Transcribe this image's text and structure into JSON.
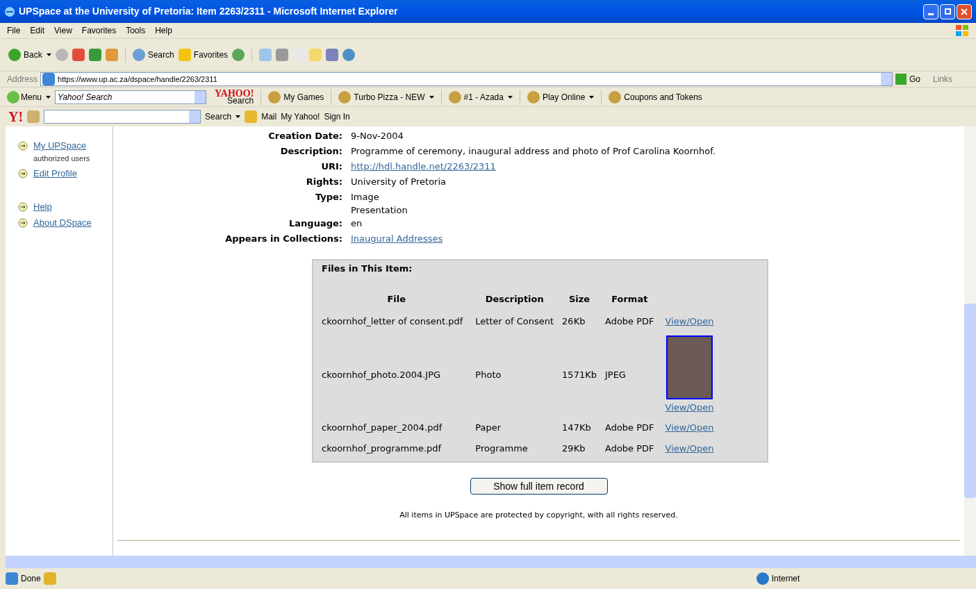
{
  "window": {
    "title": "UPSpace at the University of Pretoria: Item 2263/2311 - Microsoft Internet Explorer"
  },
  "menu_bar": [
    "File",
    "Edit",
    "View",
    "Favorites",
    "Tools",
    "Help"
  ],
  "toolbar": {
    "back": "Back",
    "search": "Search",
    "favorites": "Favorites"
  },
  "address_bar": {
    "label": "Address",
    "value": "https://www.up.ac.za/dspace/handle/2263/2311",
    "go": "Go",
    "links": "Links"
  },
  "yahoo_toolbar": {
    "menu": "Menu",
    "search_value": "Yahoo! Search",
    "logo": "YAHOO!",
    "logo_sub": "Search",
    "items": [
      {
        "label": "My Games",
        "dropdown": false
      },
      {
        "label": "Turbo Pizza - NEW",
        "dropdown": true
      },
      {
        "label": "#1 - Azada",
        "dropdown": true
      },
      {
        "label": "Play Online",
        "dropdown": true
      },
      {
        "label": "Coupons and Tokens",
        "dropdown": false
      }
    ]
  },
  "yahoo_toolbar_2": {
    "logo": "Y!",
    "search": "Search",
    "items": [
      "Mail",
      "My Yahoo!",
      "Sign In"
    ]
  },
  "sidebar": {
    "items": [
      {
        "label": "My UPSpace",
        "note": "authorized users"
      },
      {
        "label": "Edit Profile"
      },
      {
        "label": "Help"
      },
      {
        "label": "About DSpace"
      }
    ]
  },
  "metadata": [
    {
      "label": "Creation Date:",
      "kind": "text",
      "values": [
        "9-Nov-2004"
      ]
    },
    {
      "label": "Description:",
      "kind": "text",
      "values": [
        "Programme of ceremony, inaugural address and photo of Prof Carolina Koornhof."
      ]
    },
    {
      "label": "URI:",
      "kind": "link",
      "values": [
        "http://hdl.handle.net/2263/2311"
      ]
    },
    {
      "label": "Rights:",
      "kind": "text",
      "values": [
        "University of Pretoria"
      ]
    },
    {
      "label": "Type:",
      "kind": "text",
      "values": [
        "Image",
        "Presentation"
      ]
    },
    {
      "label": "Language:",
      "kind": "text",
      "values": [
        "en"
      ]
    },
    {
      "label": "Appears in Collections:",
      "kind": "link",
      "values": [
        "Inaugural Addresses"
      ]
    }
  ],
  "files": {
    "title": "Files in This Item:",
    "columns": [
      "File",
      "Description",
      "Size",
      "Format"
    ],
    "rows": [
      {
        "file": "ckoornhof_letter of consent.pdf",
        "description": "Letter of Consent",
        "size": "26Kb",
        "format": "Adobe PDF",
        "link": "View/Open",
        "thumbnail": false
      },
      {
        "file": "ckoornhof_photo.2004.JPG",
        "description": "Photo",
        "size": "1571Kb",
        "format": "JPEG",
        "link": "View/Open",
        "thumbnail": true
      },
      {
        "file": "ckoornhof_paper_2004.pdf",
        "description": "Paper",
        "size": "147Kb",
        "format": "Adobe PDF",
        "link": "View/Open",
        "thumbnail": false
      },
      {
        "file": "ckoornhof_programme.pdf",
        "description": "Programme",
        "size": "29Kb",
        "format": "Adobe PDF",
        "link": "View/Open",
        "thumbnail": false
      }
    ]
  },
  "full_record_button": "Show full item record",
  "footer": "All items in UPSpace are protected by copyright, with all rights reserved.",
  "status_bar": {
    "text": "Done",
    "zone": "Internet"
  }
}
